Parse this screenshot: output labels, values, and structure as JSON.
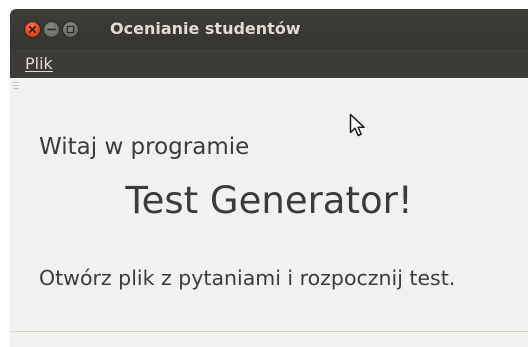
{
  "window": {
    "title": "Ocenianie studentów"
  },
  "menubar": {
    "items": [
      {
        "label": "Plik"
      }
    ]
  },
  "main": {
    "welcome": "Witaj w programie",
    "app_name": "Test Generator!",
    "instruction": "Otwórz plik z pytaniami i rozpocznij test."
  },
  "colors": {
    "titlebar": "#3c3b37",
    "close_button": "#e1451e",
    "window_bg": "#f2f1f0",
    "text": "#3c3c3c"
  },
  "icons": {
    "close": "close-icon",
    "minimize": "minimize-icon",
    "maximize": "maximize-icon",
    "cursor": "mouse-pointer-icon"
  }
}
